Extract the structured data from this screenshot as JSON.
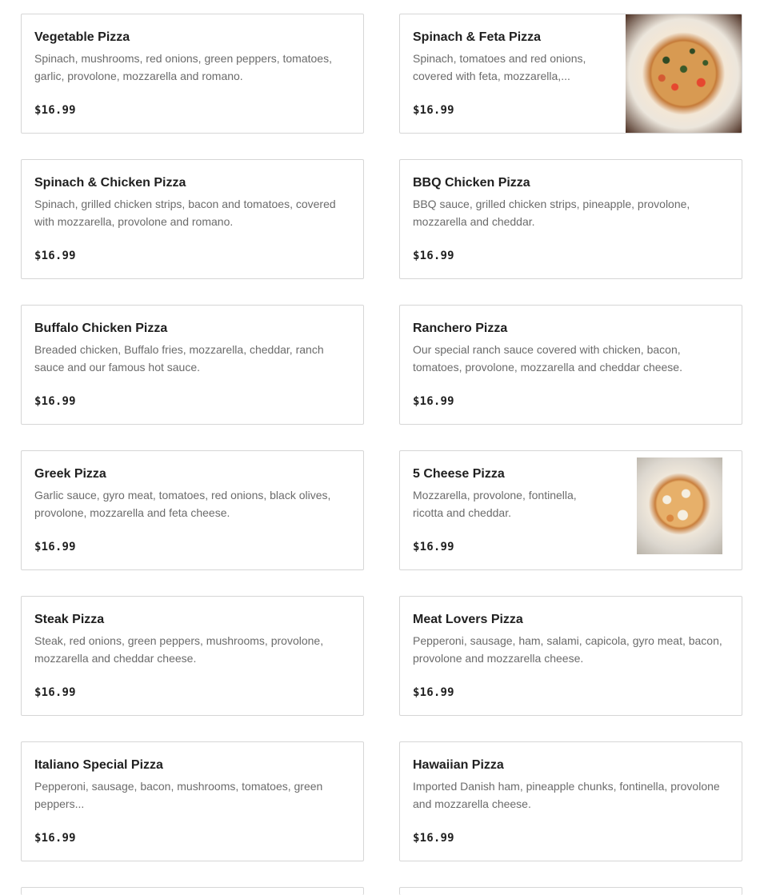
{
  "menu": {
    "items": [
      {
        "name": "Vegetable Pizza",
        "description": "Spinach, mushrooms, red onions, green peppers, tomatoes, garlic, provolone, mozzarella and romano.",
        "price": "$16.99",
        "image": "none"
      },
      {
        "name": "Spinach & Feta Pizza",
        "description": "Spinach, tomatoes and red onions, covered with feta, mozzarella,...",
        "price": "$16.99",
        "image": "pizza-photo"
      },
      {
        "name": "Spinach & Chicken Pizza",
        "description": "Spinach, grilled chicken strips, bacon and tomatoes, covered with mozzarella, provolone and romano.",
        "price": "$16.99",
        "image": "none"
      },
      {
        "name": "BBQ Chicken Pizza",
        "description": "BBQ sauce, grilled chicken strips, pineapple, provolone, mozzarella and cheddar.",
        "price": "$16.99",
        "image": "none"
      },
      {
        "name": "Buffalo Chicken Pizza",
        "description": "Breaded chicken, Buffalo fries, mozzarella, cheddar, ranch sauce and our famous hot sauce.",
        "price": "$16.99",
        "image": "none"
      },
      {
        "name": "Ranchero Pizza",
        "description": "Our special ranch sauce covered with chicken, bacon, tomatoes, provolone, mozzarella and cheddar cheese.",
        "price": "$16.99",
        "image": "none"
      },
      {
        "name": "Greek Pizza",
        "description": "Garlic sauce, gyro meat, tomatoes, red onions, black olives, provolone, mozzarella and feta cheese.",
        "price": "$16.99",
        "image": "none"
      },
      {
        "name": "5 Cheese Pizza",
        "description": "Mozzarella, provolone, fontinella, ricotta and cheddar.",
        "price": "$16.99",
        "image": "pizza-thumbnail"
      },
      {
        "name": "Steak Pizza",
        "description": "Steak, red onions, green peppers, mushrooms, provolone, mozzarella and cheddar cheese.",
        "price": "$16.99",
        "image": "none"
      },
      {
        "name": "Meat Lovers Pizza",
        "description": "Pepperoni, sausage, ham, salami, capicola, gyro meat, bacon, provolone and mozzarella cheese.",
        "price": "$16.99",
        "image": "none"
      },
      {
        "name": "Italiano Special Pizza",
        "description": "Pepperoni, sausage, bacon, mushrooms, tomatoes, green peppers...",
        "price": "$16.99",
        "image": "none"
      },
      {
        "name": "Hawaiian Pizza",
        "description": "Imported Danish ham, pineapple chunks, fontinella, provolone and mozzarella cheese.",
        "price": "$16.99",
        "image": "none"
      }
    ]
  },
  "colors": {
    "border": "#d6d6d6",
    "title": "#1f1f1f",
    "description": "#6b6b6b",
    "background": "#ffffff"
  }
}
